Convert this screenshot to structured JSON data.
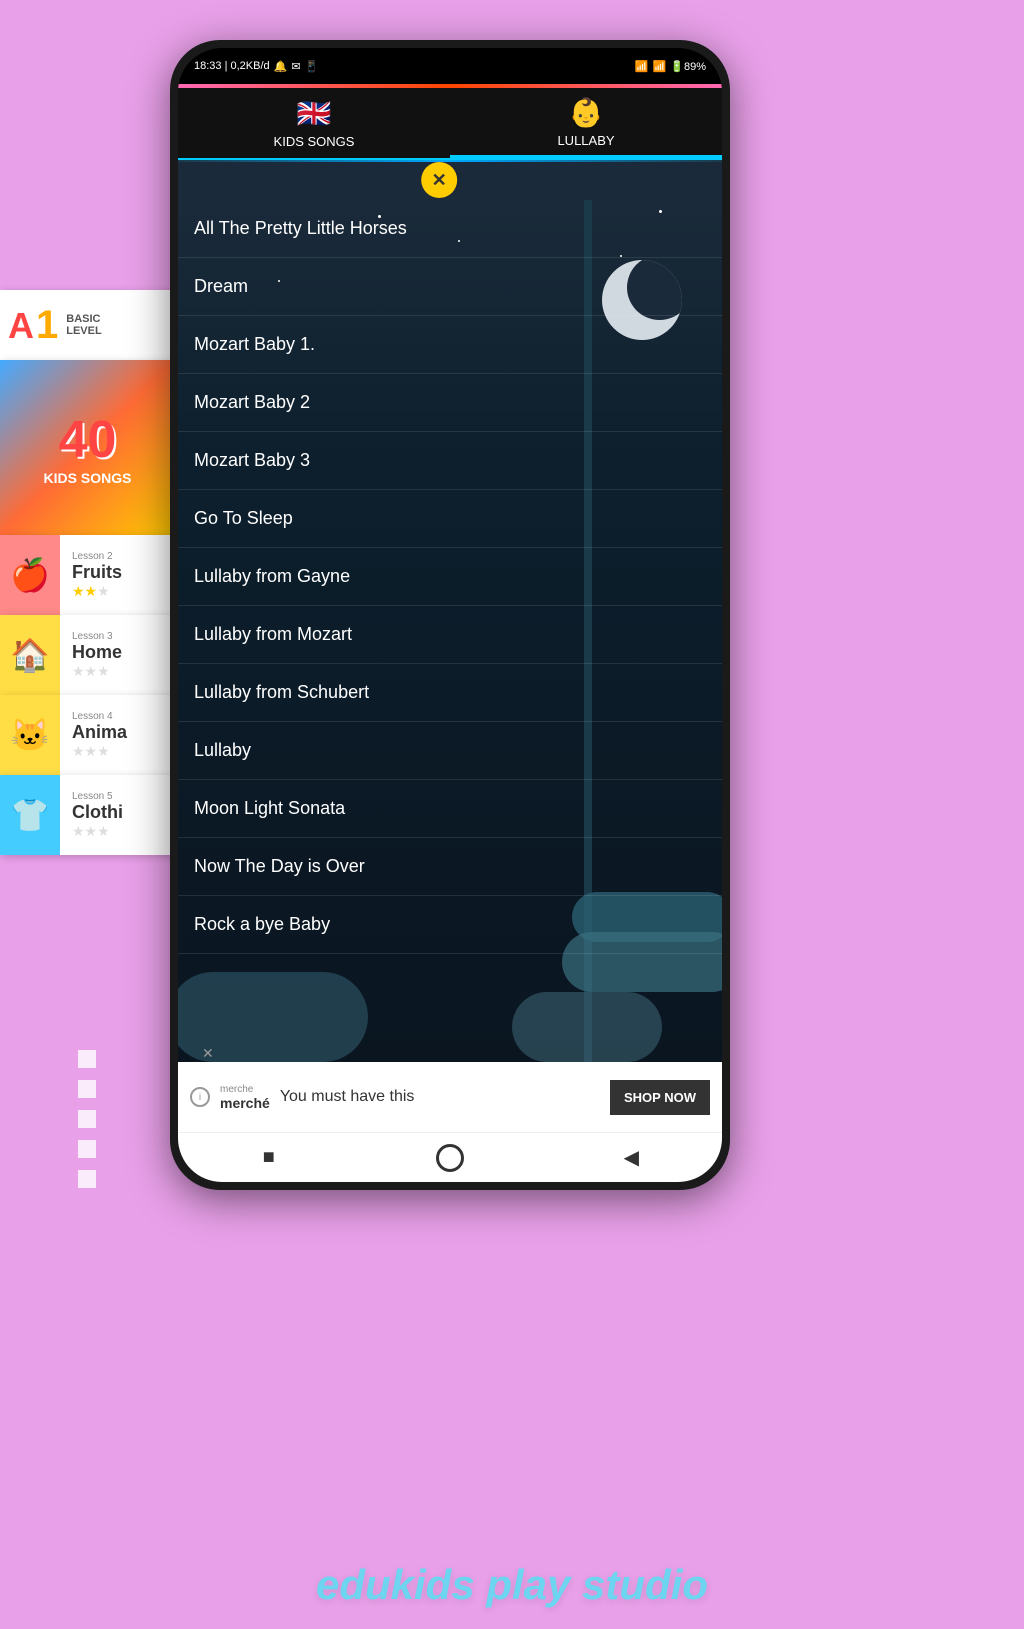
{
  "page": {
    "background_color": "#e8a0e8",
    "brand_text": "edukids play studio"
  },
  "status_bar": {
    "time": "18:33 | 0,2KB/d",
    "icons": [
      "notification-bell",
      "message-icon",
      "whatsapp-icon"
    ],
    "signal": "●●●●",
    "battery": "89"
  },
  "tabs": [
    {
      "id": "kids-songs",
      "label": "KIDS SONGS",
      "icon": "🇬🇧",
      "active": false
    },
    {
      "id": "lullaby",
      "label": "LULLABY",
      "icon": "👶",
      "active": true
    }
  ],
  "close_button": "✕",
  "songs": [
    {
      "id": 1,
      "title": "All The Pretty Little Horses"
    },
    {
      "id": 2,
      "title": "Dream"
    },
    {
      "id": 3,
      "title": "Mozart Baby 1"
    },
    {
      "id": 4,
      "title": "Mozart Baby 2"
    },
    {
      "id": 5,
      "title": "Mozart Baby 3"
    },
    {
      "id": 6,
      "title": "Go To Sleep"
    },
    {
      "id": 7,
      "title": "Lullaby from Gayne"
    },
    {
      "id": 8,
      "title": "Lullaby from Mozart"
    },
    {
      "id": 9,
      "title": "Lullaby from Schubert"
    },
    {
      "id": 10,
      "title": "Lullaby"
    },
    {
      "id": 11,
      "title": "Moon Light Sonata"
    },
    {
      "id": 12,
      "title": "Now The Day is Over"
    },
    {
      "id": 13,
      "title": "Rock a bye Baby"
    }
  ],
  "ad": {
    "brand": "merché",
    "brand_label": "merche",
    "text": "You must have this",
    "button_label": "SHOP NOW"
  },
  "nav": {
    "square_icon": "■",
    "circle_icon": "○",
    "back_icon": "◀"
  },
  "a1_card": {
    "badge_a": "A",
    "badge_1": "1",
    "level_line1": "BASIC",
    "level_line2": "LEVEL"
  },
  "kids_songs_banner": {
    "number": "40",
    "subtitle": "KIDS SONGS"
  },
  "lessons": [
    {
      "id": 2,
      "number": "Lesson 2",
      "name": "Fruits",
      "icon": "🍎",
      "color": "#ff6666",
      "stars": 2,
      "max_stars": 3
    },
    {
      "id": 3,
      "number": "Lesson 3",
      "name": "Home",
      "icon": "🏠",
      "color": "#ffcc44",
      "stars": 0,
      "max_stars": 3
    },
    {
      "id": 4,
      "number": "Lesson 4",
      "name": "Anima",
      "icon": "🐱",
      "color": "#ffcc44",
      "stars": 0,
      "max_stars": 3
    },
    {
      "id": 5,
      "number": "Lesson 5",
      "name": "Clothi",
      "icon": "👕",
      "color": "#44ccff",
      "stars": 0,
      "max_stars": 3
    }
  ],
  "page_dots": [
    1,
    2,
    3,
    4,
    5
  ]
}
